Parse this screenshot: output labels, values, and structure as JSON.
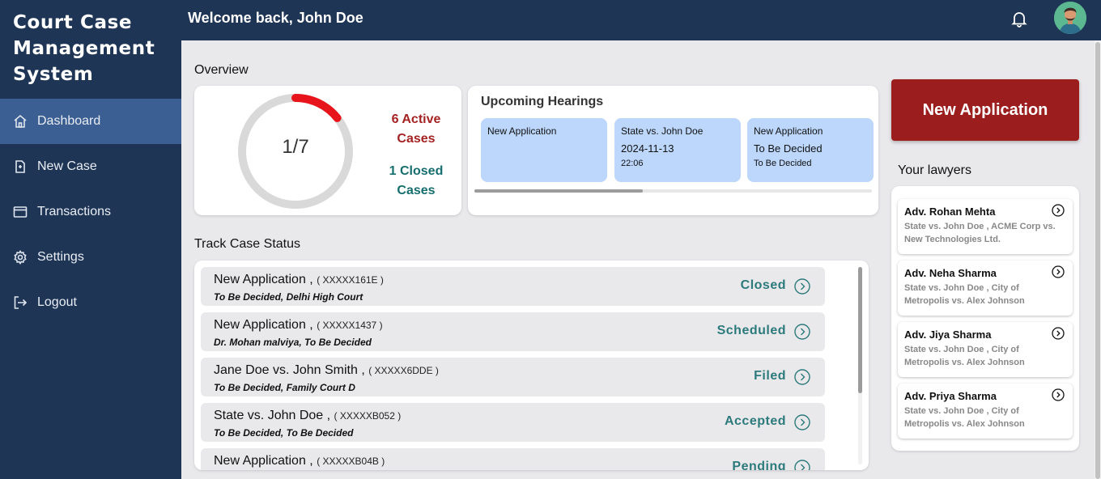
{
  "app": {
    "title": "Court Case Management System"
  },
  "sidebar": {
    "items": [
      {
        "label": "Dashboard",
        "icon": "home-icon",
        "active": true
      },
      {
        "label": "New Case",
        "icon": "document-icon",
        "active": false
      },
      {
        "label": "Transactions",
        "icon": "card-icon",
        "active": false
      },
      {
        "label": "Settings",
        "icon": "gear-icon",
        "active": false
      },
      {
        "label": "Logout",
        "icon": "logout-icon",
        "active": false
      }
    ]
  },
  "header": {
    "welcome": "Welcome back, John Doe",
    "icons": [
      "bell-icon",
      "avatar"
    ]
  },
  "overview": {
    "title": "Overview",
    "progress_label": "1/7",
    "progress_fraction": 0.142857,
    "active_cases": "6 Active Cases",
    "closed_cases": "1 Closed Cases"
  },
  "hearings": {
    "title": "Upcoming Hearings",
    "items": [
      {
        "title": "New Application",
        "date": "",
        "time": ""
      },
      {
        "title": "State vs. John Doe",
        "date": "2024-11-13",
        "time": "22:06"
      },
      {
        "title": "New Application",
        "date": "To Be Decided",
        "time": "To Be Decided"
      }
    ]
  },
  "track": {
    "title": "Track Case Status",
    "cases": [
      {
        "name": "New Application ,",
        "id": "( XXXXX161E )",
        "sub": "To Be Decided, Delhi High Court",
        "status": "Closed"
      },
      {
        "name": "New Application ,",
        "id": "( XXXXX1437 )",
        "sub": "Dr. Mohan malviya, To Be Decided",
        "status": "Scheduled"
      },
      {
        "name": "Jane Doe vs. John Smith ,",
        "id": "( XXXXX6DDE )",
        "sub": "To Be Decided, Family Court D",
        "status": "Filed"
      },
      {
        "name": "State vs. John Doe ,",
        "id": "( XXXXXB052 )",
        "sub": "To Be Decided, To Be Decided",
        "status": "Accepted"
      },
      {
        "name": "New Application ,",
        "id": "( XXXXXB04B )",
        "sub": "",
        "status": "Pending"
      }
    ]
  },
  "actions": {
    "new_application": "New Application"
  },
  "lawyers": {
    "title": "Your lawyers",
    "items": [
      {
        "name": "Adv. Rohan Mehta",
        "cases": "State vs. John Doe , ACME Corp vs. New Technologies Ltd."
      },
      {
        "name": "Adv. Neha Sharma",
        "cases": "State vs. John Doe , City of Metropolis vs. Alex Johnson"
      },
      {
        "name": "Adv. Jiya Sharma",
        "cases": "State vs. John Doe , City of Metropolis vs. Alex Johnson"
      },
      {
        "name": "Adv. Priya Sharma",
        "cases": "State vs. John Doe , City of Metropolis vs. Alex Johnson"
      }
    ]
  },
  "colors": {
    "navy": "#1f3555",
    "active_nav": "#3b5e93",
    "danger": "#9b1d1d",
    "teal": "#2c7a7b",
    "hearing_card": "#bcd7fb",
    "ring_red": "#e8141b"
  }
}
